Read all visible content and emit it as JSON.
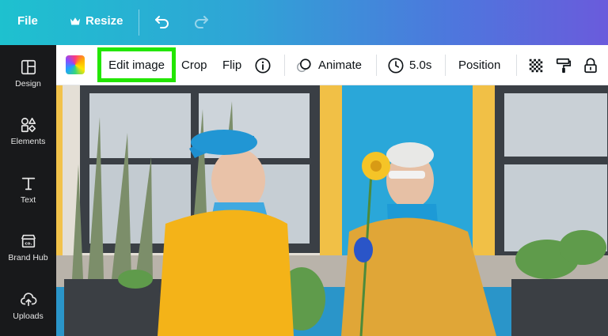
{
  "topbar": {
    "file_label": "File",
    "resize_label": "Resize",
    "icons": {
      "resize": "crown-icon",
      "undo": "undo-icon",
      "redo": "redo-icon"
    }
  },
  "sidebar": {
    "items": [
      {
        "label": "Design",
        "icon": "layout-icon"
      },
      {
        "label": "Elements",
        "icon": "shapes-icon"
      },
      {
        "label": "Text",
        "icon": "text-icon"
      },
      {
        "label": "Brand Hub",
        "icon": "brand-hub-icon"
      },
      {
        "label": "Uploads",
        "icon": "upload-cloud-icon"
      }
    ]
  },
  "toolbar": {
    "edit_image_label": "Edit image",
    "crop_label": "Crop",
    "flip_label": "Flip",
    "animate_label": "Animate",
    "duration_label": "5.0s",
    "position_label": "Position",
    "icons": {
      "color": "color-swatch-icon",
      "info": "info-icon",
      "animate": "animate-icon",
      "duration": "clock-icon",
      "transparency": "transparency-icon",
      "paint": "paint-roller-icon",
      "lock": "lock-icon"
    },
    "highlight_color": "#23e600"
  },
  "colors": {
    "topbar_start": "#1ec1cf",
    "topbar_end": "#6a5bdc",
    "sidebar_bg": "#18191b"
  }
}
